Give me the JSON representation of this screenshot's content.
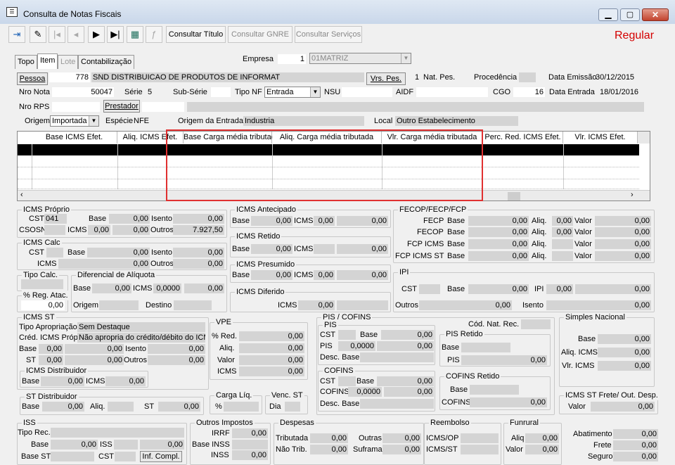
{
  "window": {
    "title": "Consulta de Notas Fiscais",
    "status": "Regular"
  },
  "toolbar": {
    "consultar_titulo": "Consultar Título",
    "consultar_gnre": "Consultar GNRE",
    "consultar_servicos": "Consultar Serviços"
  },
  "tabs": [
    "Topo",
    "Item",
    "Lote",
    "Contabilização"
  ],
  "header": {
    "empresa_label": "Empresa",
    "empresa_code": "1",
    "empresa_name": "01MATRIZ",
    "pessoa_button": "Pessoa",
    "pessoa_code": "778",
    "pessoa_name": "SND DISTRIBUICAO DE PRODUTOS DE INFORMAT",
    "vrs_pes_button": "Vrs. Pes.",
    "nat_pes_value": "1",
    "nat_pes_label": "Nat. Pes.",
    "procedencia_label": "Procedência",
    "data_emissao_label": "Data Emissão",
    "data_emissao": "30/12/2015",
    "nro_nota_label": "Nro Nota",
    "nro_nota": "50047",
    "serie_label": "Série",
    "serie": "5",
    "subserie_label": "Sub-Série",
    "tipo_nf_label": "Tipo NF",
    "tipo_nf": "Entrada",
    "nsu_label": "NSU",
    "aidf_label": "AIDF",
    "cgo_label": "CGO",
    "cgo": "16",
    "data_entrada_label": "Data Entrada",
    "data_entrada": "18/01/2016",
    "nro_rps_label": "Nro RPS",
    "prestador_button": "Prestador",
    "origem_label": "Origem",
    "origem": "Importada",
    "especie_label": "Espécie",
    "especie": "NFE",
    "origem_entrada_label": "Origem da Entrada",
    "origem_entrada": "Industria",
    "local_label": "Local",
    "local": "Outro Estabelecimento"
  },
  "grid": {
    "columns": [
      "Base ICMS Efet.",
      "Aliq. ICMS Efet.",
      "Base Carga média tributada",
      "Aliq. Carga média tributada",
      "Vlr. Carga média tributada",
      "Perc. Red. ICMS Efet.",
      "Vlr. ICMS Efet."
    ]
  },
  "labels": {
    "base": "Base",
    "aliq": "Aliq.",
    "valor": "Valor",
    "icms": "ICMS",
    "isento": "Isento",
    "outros": "Outros",
    "cst": "CST",
    "st": "ST",
    "ipi": "IPI",
    "pis": "PIS",
    "cofins": "COFINS",
    "origem": "Origem",
    "destino": "Destino",
    "sem_destaque": "Sem Destaque",
    "percent": "%",
    "dia": "Dia",
    "red": "% Red.",
    "desc_base": "Desc. Base"
  },
  "icms_proprio": {
    "title": "ICMS Próprio",
    "cst": "041",
    "base": "0,00",
    "isento": "0,00",
    "csosn_label": "CSOSN",
    "icms": "0,00",
    "icms_val": "0,00",
    "outros": "7.927,50"
  },
  "icms_calc": {
    "title": "ICMS Calc",
    "base": "0,00",
    "isento": "0,00",
    "icms": "0,00",
    "outros": "0,00"
  },
  "tipo_calc": {
    "title": "Tipo Calc."
  },
  "reg_atac": {
    "title": "% Reg. Atac.",
    "value": "0,00"
  },
  "dif_aliquota": {
    "title": "Diferencial de Alíquota",
    "base": "0,00",
    "icms": "0,0000",
    "value": "0,00"
  },
  "icms_antecipado": {
    "title": "ICMS Antecipado",
    "base": "0,00",
    "icms": "0,00",
    "value": "0,00"
  },
  "icms_retido": {
    "title": "ICMS Retido",
    "base": "0,00",
    "value": "0,00"
  },
  "icms_presumido": {
    "title": "ICMS Presumido",
    "base": "0,00",
    "icms": "0,00",
    "value": "0,00"
  },
  "icms_diferido": {
    "title": "ICMS Diferido",
    "icms": "0,00"
  },
  "fecop": {
    "title": "FECOP/FECP/FCP",
    "rows": [
      {
        "label": "FECP",
        "base": "0,00",
        "aliq": "0,00",
        "valor": "0,00"
      },
      {
        "label": "FECOP",
        "base": "0,00",
        "aliq": "0,00",
        "valor": "0,00"
      },
      {
        "label": "FCP ICMS",
        "base": "0,00",
        "aliq": "",
        "valor": "0,00"
      },
      {
        "label": "FCP ICMS ST",
        "base": "0,00",
        "aliq": "",
        "valor": "0,00"
      }
    ]
  },
  "ipi": {
    "title": "IPI",
    "base": "0,00",
    "ipi": "0,00",
    "value": "0,00",
    "outros": "0,00",
    "isento": "0,00"
  },
  "icms_st": {
    "title": "ICMS ST",
    "tipo_apropriacao_label": "Tipo Apropriação",
    "cred_label": "Créd. ICMS Próp.",
    "cred_value": "Não apropria do crédito/débito do ICMS",
    "base": "0,00",
    "base_val": "0,00",
    "isento": "0,00",
    "st": "0,00",
    "st_val": "0,00",
    "outros": "0,00"
  },
  "icms_distribuidor": {
    "title": "ICMS Distribuidor",
    "base": "0,00",
    "icms": "0,00"
  },
  "st_distribuidor": {
    "title": "ST Distribuidor",
    "base": "0,00",
    "aliq": "",
    "st": "0,00"
  },
  "vpe": {
    "title": "VPE",
    "red": "0,00",
    "aliq": "0,00",
    "valor": "0,00",
    "icms": "0,00"
  },
  "carga_liq": {
    "title": "Carga Líq."
  },
  "venc_st": {
    "title": "Venc. ST"
  },
  "pis_cofins": {
    "title": "PIS / COFINS",
    "cod_nat_rec_label": "Cód. Nat. Rec.",
    "pis": {
      "title": "PIS",
      "base": "0,00",
      "pis": "0,0000",
      "pis_val": "0,00"
    },
    "pis_retido": {
      "title": "PIS Retido",
      "pis": "0,00"
    },
    "cofins": {
      "title": "COFINS",
      "base": "0,00",
      "cofins": "0,0000",
      "cofins_val": "0,00"
    },
    "cofins_retido": {
      "title": "COFINS Retido",
      "cofins": "0,00"
    }
  },
  "simples": {
    "title": "Simples Nacional",
    "base": "0,00",
    "aliq_label": "Aliq. ICMS",
    "aliq": "0,00",
    "vlr_label": "Vlr. ICMS",
    "vlr": "0,00"
  },
  "icms_st_frete": {
    "title": "ICMS ST Frete/ Out. Desp.",
    "valor": "0,00"
  },
  "iss": {
    "title": "ISS",
    "tipo_rec_label": "Tipo Rec.",
    "base": "0,00",
    "iss": "0,00",
    "base_st_label": "Base ST",
    "inf_compl": "Inf. Compl."
  },
  "outros_impostos": {
    "title": "Outros Impostos",
    "irrf_label": "IRRF",
    "irrf": "0,00",
    "base_inss_label": "Base INSS",
    "inss_label": "INSS",
    "inss": "0,00"
  },
  "despesas": {
    "title": "Despesas",
    "tributada_label": "Tributada",
    "tributada": "0,00",
    "outras_label": "Outras",
    "outras": "0,00",
    "nao_trib_label": "Não Trib.",
    "nao_trib": "0,00",
    "suframa_label": "Suframa",
    "suframa": "0,00"
  },
  "reembolso": {
    "title": "Reembolso",
    "icms_op_label": "ICMS/OP",
    "icms_st_label": "ICMS/ST"
  },
  "funrural": {
    "title": "Funrural",
    "aliq_label": "Aliq",
    "aliq": "0,00",
    "valor_label": "Valor",
    "valor": "0,00"
  },
  "totais": {
    "abatimento_label": "Abatimento",
    "abatimento": "0,00",
    "frete_label": "Frete",
    "frete": "0,00",
    "seguro_label": "Seguro",
    "seguro": "0,00"
  }
}
